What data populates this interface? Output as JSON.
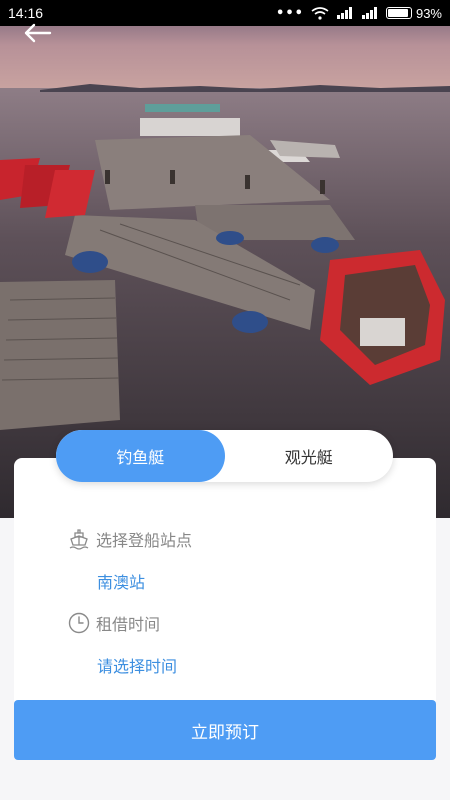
{
  "status_bar": {
    "time": "14:16",
    "dots": "•••",
    "battery": "93%",
    "battery_level": 0.93
  },
  "header": {
    "back_icon": "arrow-left-icon"
  },
  "tabs": [
    {
      "label": "钓鱼艇",
      "active": true
    },
    {
      "label": "观光艇",
      "active": false
    }
  ],
  "form": {
    "station": {
      "label": "选择登船站点",
      "value": "南澳站",
      "icon": "boat-icon"
    },
    "time": {
      "label": "租借时间",
      "value": "请选择时间",
      "icon": "clock-icon"
    }
  },
  "actions": {
    "book_label": "立即预订"
  },
  "colors": {
    "accent": "#4e9cf4",
    "link": "#3d8fe0"
  }
}
